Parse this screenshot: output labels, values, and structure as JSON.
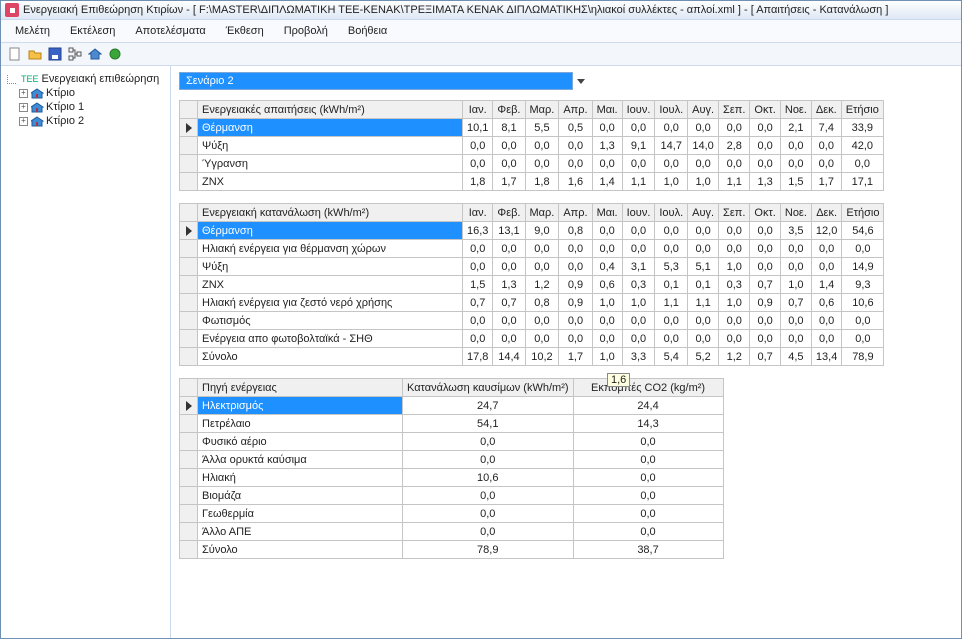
{
  "title": "Ενεργειακή Επιθεώρηση Κτιρίων - [ F:\\MASTER\\ΔΙΠΛΩΜΑΤΙΚΗ ΤΕΕ-ΚΕΝΑΚ\\ΤΡΕΞΙΜΑΤΑ ΚΕΝΑΚ ΔΙΠΛΩΜΑΤΙΚΗΣ\\ηλιακοί συλλέκτες - απλοί.xml ] - [ Απαιτήσεις - Κατανάλωση ]",
  "menu": [
    "Μελέτη",
    "Εκτέλεση",
    "Αποτελέσματα",
    "Έκθεση",
    "Προβολή",
    "Βοήθεια"
  ],
  "tree": {
    "root": "Ενεργειακή επιθεώρηση",
    "items": [
      "Κτίριο",
      "Κτίριο 1",
      "Κτίριο 2"
    ]
  },
  "scenario": "Σενάριο 2",
  "months": [
    "Ιαν.",
    "Φεβ.",
    "Μαρ.",
    "Απρ.",
    "Μαι.",
    "Ιουν.",
    "Ιουλ.",
    "Αυγ.",
    "Σεπ.",
    "Οκτ.",
    "Νοε.",
    "Δεκ.",
    "Ετήσιο"
  ],
  "table1": {
    "header": "Ενεργειακές απαιτήσεις (kWh/m²)",
    "rows": [
      {
        "label": "Θέρμανση",
        "selected": true,
        "v": [
          "10,1",
          "8,1",
          "5,5",
          "0,5",
          "0,0",
          "0,0",
          "0,0",
          "0,0",
          "0,0",
          "0,0",
          "2,1",
          "7,4",
          "33,9"
        ]
      },
      {
        "label": "Ψύξη",
        "v": [
          "0,0",
          "0,0",
          "0,0",
          "0,0",
          "1,3",
          "9,1",
          "14,7",
          "14,0",
          "2,8",
          "0,0",
          "0,0",
          "0,0",
          "42,0"
        ]
      },
      {
        "label": "Ύγρανση",
        "v": [
          "0,0",
          "0,0",
          "0,0",
          "0,0",
          "0,0",
          "0,0",
          "0,0",
          "0,0",
          "0,0",
          "0,0",
          "0,0",
          "0,0",
          "0,0"
        ]
      },
      {
        "label": "ZNX",
        "v": [
          "1,8",
          "1,7",
          "1,8",
          "1,6",
          "1,4",
          "1,1",
          "1,0",
          "1,0",
          "1,1",
          "1,3",
          "1,5",
          "1,7",
          "17,1"
        ]
      }
    ]
  },
  "table2": {
    "header": "Ενεργειακή κατανάλωση (kWh/m²)",
    "rows": [
      {
        "label": "Θέρμανση",
        "selected": true,
        "v": [
          "16,3",
          "13,1",
          "9,0",
          "0,8",
          "0,0",
          "0,0",
          "0,0",
          "0,0",
          "0,0",
          "0,0",
          "3,5",
          "12,0",
          "54,6"
        ]
      },
      {
        "label": "Ηλιακή ενέργεια για θέρμανση χώρων",
        "v": [
          "0,0",
          "0,0",
          "0,0",
          "0,0",
          "0,0",
          "0,0",
          "0,0",
          "0,0",
          "0,0",
          "0,0",
          "0,0",
          "0,0",
          "0,0"
        ]
      },
      {
        "label": "Ψύξη",
        "v": [
          "0,0",
          "0,0",
          "0,0",
          "0,0",
          "0,4",
          "3,1",
          "5,3",
          "5,1",
          "1,0",
          "0,0",
          "0,0",
          "0,0",
          "14,9"
        ]
      },
      {
        "label": "ZNX",
        "v": [
          "1,5",
          "1,3",
          "1,2",
          "0,9",
          "0,6",
          "0,3",
          "0,1",
          "0,1",
          "0,3",
          "0,7",
          "1,0",
          "1,4",
          "9,3"
        ]
      },
      {
        "label": "Ηλιακή ενέργεια για ζεστό νερό χρήσης",
        "v": [
          "0,7",
          "0,7",
          "0,8",
          "0,9",
          "1,0",
          "1,0",
          "1,1",
          "1,1",
          "1,0",
          "0,9",
          "0,7",
          "0,6",
          "10,6"
        ]
      },
      {
        "label": "Φωτισμός",
        "v": [
          "0,0",
          "0,0",
          "0,0",
          "0,0",
          "0,0",
          "0,0",
          "0,0",
          "0,0",
          "0,0",
          "0,0",
          "0,0",
          "0,0",
          "0,0"
        ]
      },
      {
        "label": "Ενέργεια απο φωτοβολταϊκά - ΣΗΘ",
        "v": [
          "0,0",
          "0,0",
          "0,0",
          "0,0",
          "0,0",
          "0,0",
          "0,0",
          "0,0",
          "0,0",
          "0,0",
          "0,0",
          "0,0",
          "0,0"
        ]
      },
      {
        "label": "Σύνολο",
        "v": [
          "17,8",
          "14,4",
          "10,2",
          "1,7",
          "1,0",
          "3,3",
          "5,4",
          "5,2",
          "1,2",
          "0,7",
          "4,5",
          "13,4",
          "78,9"
        ]
      }
    ],
    "tooltip": "1,6"
  },
  "table3": {
    "headers": [
      "Πηγή ενέργειας",
      "Κατανάλωση καυσίμων (kWh/m²)",
      "Εκπομπές CO2 (kg/m²)"
    ],
    "rows": [
      {
        "label": "Ηλεκτρισμός",
        "selected": true,
        "v": [
          "24,7",
          "24,4"
        ]
      },
      {
        "label": "Πετρέλαιο",
        "v": [
          "54,1",
          "14,3"
        ]
      },
      {
        "label": "Φυσικό αέριο",
        "v": [
          "0,0",
          "0,0"
        ]
      },
      {
        "label": "Άλλα ορυκτά καύσιμα",
        "v": [
          "0,0",
          "0,0"
        ]
      },
      {
        "label": "Ηλιακή",
        "v": [
          "10,6",
          "0,0"
        ]
      },
      {
        "label": "Βιομάζα",
        "v": [
          "0,0",
          "0,0"
        ]
      },
      {
        "label": "Γεωθερμία",
        "v": [
          "0,0",
          "0,0"
        ]
      },
      {
        "label": "Άλλο ΑΠΕ",
        "v": [
          "0,0",
          "0,0"
        ]
      },
      {
        "label": "Σύνολο",
        "v": [
          "78,9",
          "38,7"
        ]
      }
    ]
  },
  "chart_data": [
    {
      "type": "table",
      "title": "Ενεργειακές απαιτήσεις (kWh/m²)",
      "categories": [
        "Ιαν.",
        "Φεβ.",
        "Μαρ.",
        "Απρ.",
        "Μαι.",
        "Ιουν.",
        "Ιουλ.",
        "Αυγ.",
        "Σεπ.",
        "Οκτ.",
        "Νοε.",
        "Δεκ.",
        "Ετήσιο"
      ],
      "series": [
        {
          "name": "Θέρμανση",
          "values": [
            10.1,
            8.1,
            5.5,
            0.5,
            0,
            0,
            0,
            0,
            0,
            0,
            2.1,
            7.4,
            33.9
          ]
        },
        {
          "name": "Ψύξη",
          "values": [
            0,
            0,
            0,
            0,
            1.3,
            9.1,
            14.7,
            14.0,
            2.8,
            0,
            0,
            0,
            42.0
          ]
        },
        {
          "name": "Ύγρανση",
          "values": [
            0,
            0,
            0,
            0,
            0,
            0,
            0,
            0,
            0,
            0,
            0,
            0,
            0
          ]
        },
        {
          "name": "ZNX",
          "values": [
            1.8,
            1.7,
            1.8,
            1.6,
            1.4,
            1.1,
            1.0,
            1.0,
            1.1,
            1.3,
            1.5,
            1.7,
            17.1
          ]
        }
      ]
    },
    {
      "type": "table",
      "title": "Ενεργειακή κατανάλωση (kWh/m²)",
      "categories": [
        "Ιαν.",
        "Φεβ.",
        "Μαρ.",
        "Απρ.",
        "Μαι.",
        "Ιουν.",
        "Ιουλ.",
        "Αυγ.",
        "Σεπ.",
        "Οκτ.",
        "Νοε.",
        "Δεκ.",
        "Ετήσιο"
      ],
      "series": [
        {
          "name": "Θέρμανση",
          "values": [
            16.3,
            13.1,
            9.0,
            0.8,
            0,
            0,
            0,
            0,
            0,
            0,
            3.5,
            12.0,
            54.6
          ]
        },
        {
          "name": "Ηλιακή ενέργεια για θέρμανση χώρων",
          "values": [
            0,
            0,
            0,
            0,
            0,
            0,
            0,
            0,
            0,
            0,
            0,
            0,
            0
          ]
        },
        {
          "name": "Ψύξη",
          "values": [
            0,
            0,
            0,
            0,
            0.4,
            3.1,
            5.3,
            5.1,
            1.0,
            0,
            0,
            0,
            14.9
          ]
        },
        {
          "name": "ZNX",
          "values": [
            1.5,
            1.3,
            1.2,
            0.9,
            0.6,
            0.3,
            0.1,
            0.1,
            0.3,
            0.7,
            1.0,
            1.4,
            9.3
          ]
        },
        {
          "name": "Ηλιακή ενέργεια για ζεστό νερό χρήσης",
          "values": [
            0.7,
            0.7,
            0.8,
            0.9,
            1.0,
            1.0,
            1.1,
            1.1,
            1.0,
            0.9,
            0.7,
            0.6,
            10.6
          ]
        },
        {
          "name": "Φωτισμός",
          "values": [
            0,
            0,
            0,
            0,
            0,
            0,
            0,
            0,
            0,
            0,
            0,
            0,
            0
          ]
        },
        {
          "name": "Ενέργεια απο φωτοβολταϊκά - ΣΗΘ",
          "values": [
            0,
            0,
            0,
            0,
            0,
            0,
            0,
            0,
            0,
            0,
            0,
            0,
            0
          ]
        },
        {
          "name": "Σύνολο",
          "values": [
            17.8,
            14.4,
            10.2,
            1.7,
            1.0,
            3.3,
            5.4,
            5.2,
            1.2,
            0.7,
            4.5,
            13.4,
            78.9
          ]
        }
      ]
    },
    {
      "type": "table",
      "title": "Πηγή ενέργειας",
      "categories": [
        "Κατανάλωση καυσίμων (kWh/m²)",
        "Εκπομπές CO2 (kg/m²)"
      ],
      "series": [
        {
          "name": "Ηλεκτρισμός",
          "values": [
            24.7,
            24.4
          ]
        },
        {
          "name": "Πετρέλαιο",
          "values": [
            54.1,
            14.3
          ]
        },
        {
          "name": "Φυσικό αέριο",
          "values": [
            0,
            0
          ]
        },
        {
          "name": "Άλλα ορυκτά καύσιμα",
          "values": [
            0,
            0
          ]
        },
        {
          "name": "Ηλιακή",
          "values": [
            10.6,
            0
          ]
        },
        {
          "name": "Βιομάζα",
          "values": [
            0,
            0
          ]
        },
        {
          "name": "Γεωθερμία",
          "values": [
            0,
            0
          ]
        },
        {
          "name": "Άλλο ΑΠΕ",
          "values": [
            0,
            0
          ]
        },
        {
          "name": "Σύνολο",
          "values": [
            78.9,
            38.7
          ]
        }
      ]
    }
  ]
}
